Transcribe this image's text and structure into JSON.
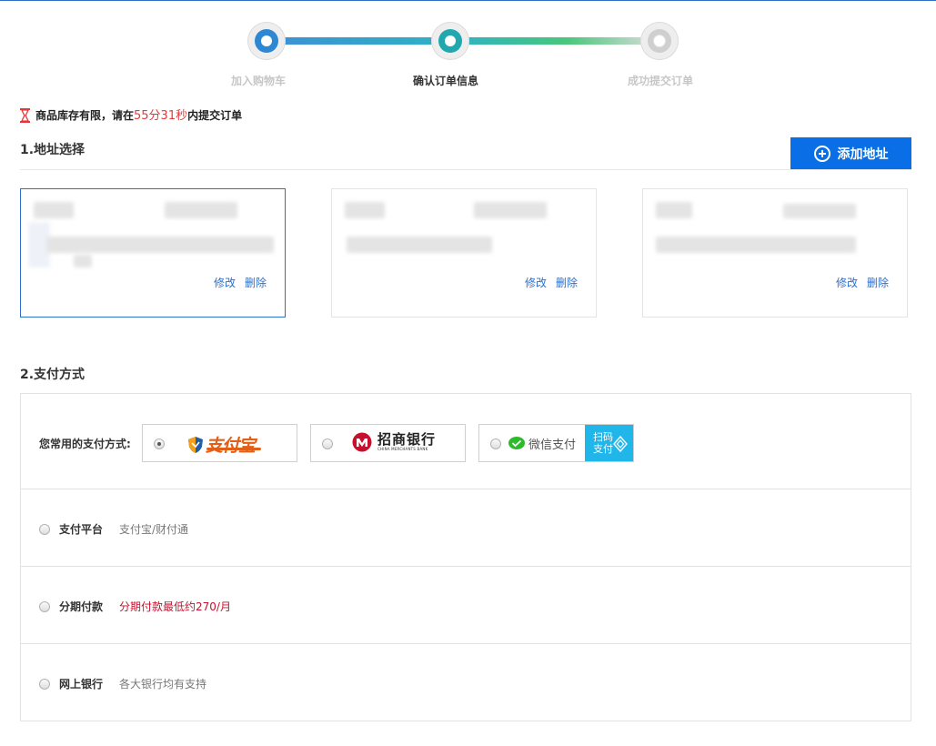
{
  "steps": [
    {
      "label": "加入购物车",
      "state": "done"
    },
    {
      "label": "确认订单信息",
      "state": "current"
    },
    {
      "label": "成功提交订单",
      "state": "pending"
    }
  ],
  "notice": {
    "prefix": "商品库存有限，请在",
    "timer": "55分31秒",
    "suffix": "内提交订单"
  },
  "address": {
    "title": "1.地址选择",
    "add_button": "添加地址",
    "cards": [
      {
        "selected": true,
        "edit": "修改",
        "delete": "删除"
      },
      {
        "selected": false,
        "edit": "修改",
        "delete": "删除"
      },
      {
        "selected": false,
        "edit": "修改",
        "delete": "删除"
      }
    ]
  },
  "payment": {
    "title": "2.支付方式",
    "favorite_label": "您常用的支付方式:",
    "options": [
      {
        "name": "支付宝",
        "checked": true
      },
      {
        "name": "招商银行",
        "en": "CHINA MERCHANTS BANK",
        "checked": false
      },
      {
        "name": "微信支付",
        "badge": "扫码\n支付",
        "checked": false
      }
    ],
    "methods": [
      {
        "name": "支付平台",
        "desc": "支付宝/财付通",
        "desc_color": "#777777"
      },
      {
        "name": "分期付款",
        "desc": "分期付款最低约270/月",
        "desc_color": "#c8102e"
      },
      {
        "name": "网上银行",
        "desc": "各大银行均有支持",
        "desc_color": "#777777"
      }
    ]
  },
  "colors": {
    "accent": "#0a6fe6",
    "selected_border": "#2d6fcb",
    "timer": "#e4393c",
    "alipay": "#e25f17",
    "wechat_badge": "#20b6ea"
  }
}
